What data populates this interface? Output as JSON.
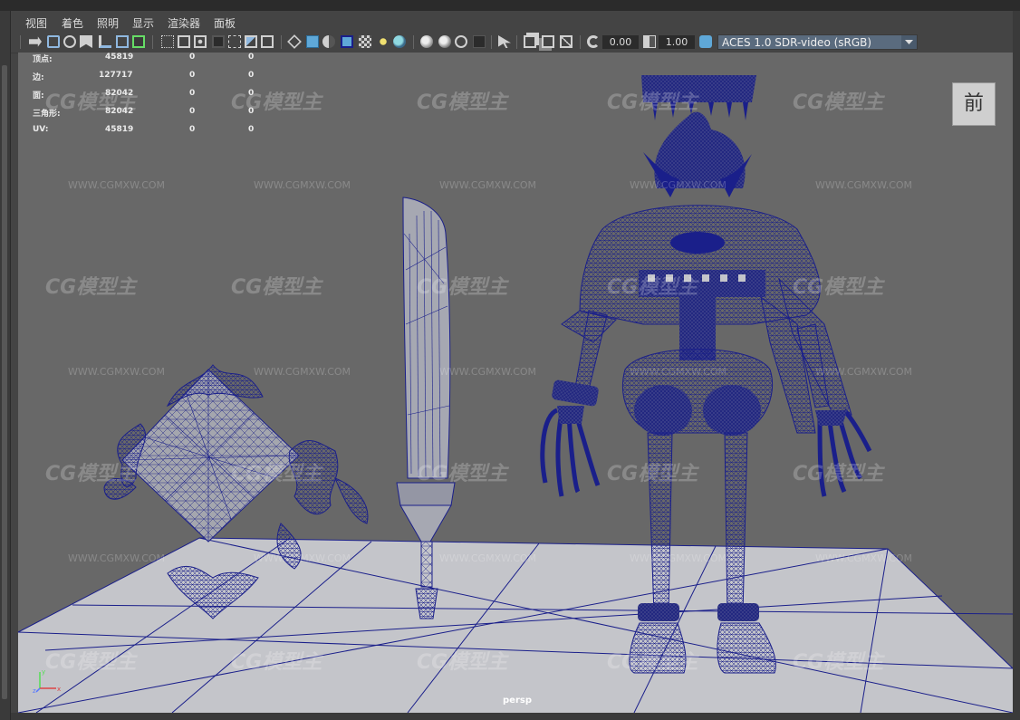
{
  "menu": {
    "items": [
      "视图",
      "着色",
      "照明",
      "显示",
      "渲染器",
      "面板"
    ]
  },
  "toolbar": {
    "exposure_value": "0.00",
    "gamma_value": "1.00",
    "color_space": "ACES 1.0 SDR-video (sRGB)"
  },
  "hud": {
    "rows": [
      {
        "label": "顶点:",
        "total": "45819",
        "selected": "0",
        "triangles": "0"
      },
      {
        "label": "边:",
        "total": "127717",
        "selected": "0",
        "triangles": "0"
      },
      {
        "label": "面:",
        "total": "82042",
        "selected": "0",
        "triangles": "0"
      },
      {
        "label": "三角形:",
        "total": "82042",
        "selected": "0",
        "triangles": "0"
      },
      {
        "label": "UV:",
        "total": "45819",
        "selected": "0",
        "triangles": "0"
      }
    ]
  },
  "viewport": {
    "view_cube_label": "前",
    "camera_name": "persp",
    "watermark_logo": "CG模型主",
    "watermark_url": "WWW.CGMXW.COM",
    "axis_labels": {
      "y": "y",
      "z": "z",
      "x": "x"
    }
  },
  "colors": {
    "wireframe": "#1a1f8a",
    "viewport_bg": "#686868",
    "floor": "#c8c8cc",
    "accent": "#5a6b7e"
  }
}
